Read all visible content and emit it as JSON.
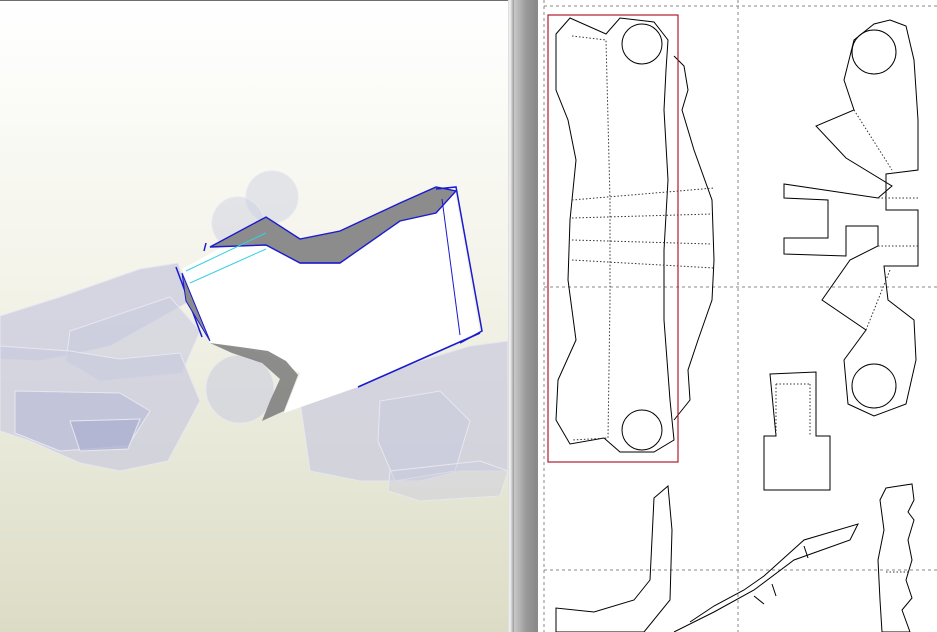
{
  "app": {
    "views": [
      {
        "id": "3d-view",
        "kind": "3D model viewport"
      },
      {
        "id": "2d-view",
        "kind": "unfolded pattern sheet"
      }
    ]
  },
  "colors": {
    "viewport_bg_top": "#ffffff",
    "viewport_bg_bottom": "#dcdcc4",
    "ghost_parts": "#c6c8dc",
    "selected_edge": "#1a1ad0",
    "fold_highlight": "#36d0e0",
    "selected_face": "#ffffff",
    "shaded_face": "#8e8e8e",
    "page_paper": "#ffffff",
    "page_margin_line": "#888888",
    "part_outline": "#000000",
    "selection_box": "#b01c2e",
    "workspace_gray": "#8a8a8a"
  },
  "sheet": {
    "margin_style": "dashed",
    "fold_line_style": "dotted",
    "selected_part": "part-1"
  }
}
